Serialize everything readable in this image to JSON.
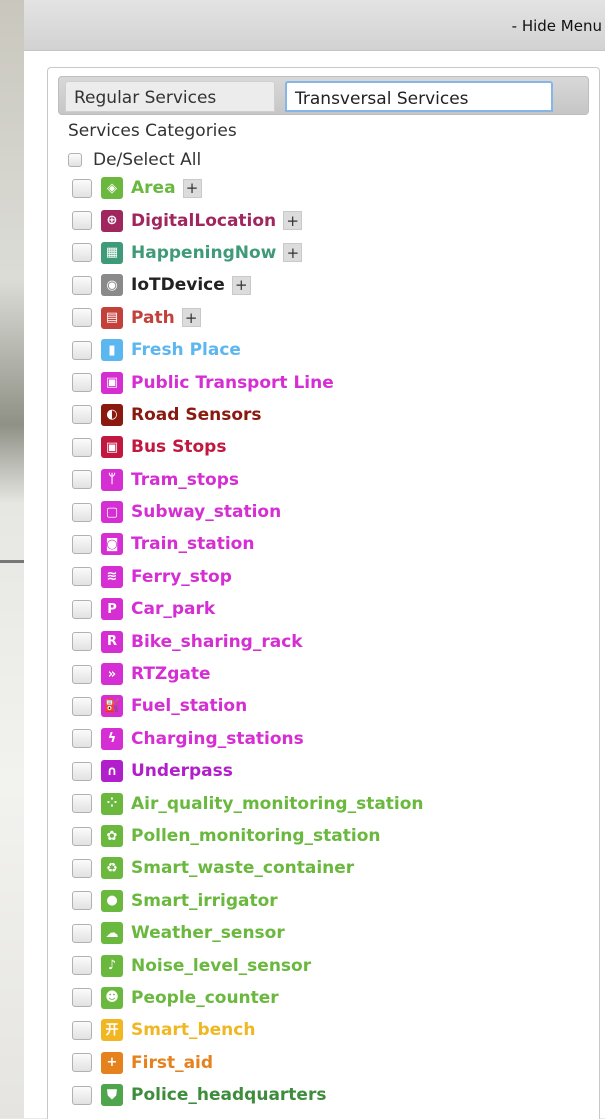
{
  "header": {
    "hide_menu": "- Hide Menu"
  },
  "tabs": [
    {
      "label": "Regular Services",
      "active": false
    },
    {
      "label": "Transversal Services",
      "active": true
    }
  ],
  "section": {
    "title": "Services Categories",
    "select_all": "De/Select All"
  },
  "categories": [
    {
      "label": "Area",
      "color": "#6ab83e",
      "icon_color": "#6ab83e",
      "icon": "area-icon",
      "glyph": "◈",
      "expandable": true,
      "plus": "+"
    },
    {
      "label": "DigitalLocation",
      "color": "#a0275e",
      "icon_color": "#a0275e",
      "icon": "digital-location-icon",
      "glyph": "⊕",
      "expandable": true,
      "plus": "+"
    },
    {
      "label": "HappeningNow",
      "color": "#3e9a78",
      "icon_color": "#3e9a78",
      "icon": "calendar-icon",
      "glyph": "▦",
      "expandable": true,
      "plus": "+"
    },
    {
      "label": "IoTDevice",
      "color": "#222222",
      "icon_color": "#8a8a8a",
      "icon": "map-pin-icon",
      "glyph": "◉",
      "expandable": true,
      "plus": "+"
    },
    {
      "label": "Path",
      "color": "#c2413b",
      "icon_color": "#c2413b",
      "icon": "path-icon",
      "glyph": "▤",
      "expandable": true,
      "plus": "+"
    },
    {
      "label": "Fresh Place",
      "color": "#5cb6f0",
      "icon_color": "#5cb6f0",
      "icon": "fresh-place-icon",
      "glyph": "▮",
      "expandable": false
    },
    {
      "label": "Public Transport Line",
      "color": "#d52ed3",
      "icon_color": "#d52ed3",
      "icon": "bus-icon",
      "glyph": "▣",
      "expandable": false
    },
    {
      "label": "Road Sensors",
      "color": "#8a1a10",
      "icon_color": "#8a1a10",
      "icon": "road-sensor-icon",
      "glyph": "◐",
      "expandable": false
    },
    {
      "label": "Bus Stops",
      "color": "#c0183e",
      "icon_color": "#c0183e",
      "icon": "bus-stop-icon",
      "glyph": "▣",
      "expandable": false
    },
    {
      "label": "Tram_stops",
      "color": "#d52ed3",
      "icon_color": "#d52ed3",
      "icon": "tram-icon",
      "glyph": "ᛘ",
      "expandable": false
    },
    {
      "label": "Subway_station",
      "color": "#d52ed3",
      "icon_color": "#d52ed3",
      "icon": "subway-icon",
      "glyph": "▢",
      "expandable": false
    },
    {
      "label": "Train_station",
      "color": "#d52ed3",
      "icon_color": "#d52ed3",
      "icon": "train-icon",
      "glyph": "◙",
      "expandable": false
    },
    {
      "label": "Ferry_stop",
      "color": "#d52ed3",
      "icon_color": "#d52ed3",
      "icon": "ferry-icon",
      "glyph": "≋",
      "expandable": false
    },
    {
      "label": "Car_park",
      "color": "#d52ed3",
      "icon_color": "#d52ed3",
      "icon": "car-park-icon",
      "glyph": "P",
      "expandable": false
    },
    {
      "label": "Bike_sharing_rack",
      "color": "#d52ed3",
      "icon_color": "#d52ed3",
      "icon": "bike-sharing-icon",
      "glyph": "R",
      "expandable": false
    },
    {
      "label": "RTZgate",
      "color": "#d52ed3",
      "icon_color": "#d52ed3",
      "icon": "gate-icon",
      "glyph": "»",
      "expandable": false
    },
    {
      "label": "Fuel_station",
      "color": "#d52ed3",
      "icon_color": "#d52ed3",
      "icon": "fuel-icon",
      "glyph": "⛽",
      "expandable": false
    },
    {
      "label": "Charging_stations",
      "color": "#d52ed3",
      "icon_color": "#d52ed3",
      "icon": "charging-icon",
      "glyph": "ϟ",
      "expandable": false
    },
    {
      "label": "Underpass",
      "color": "#b01fc9",
      "icon_color": "#b01fc9",
      "icon": "underpass-icon",
      "glyph": "∩",
      "expandable": false
    },
    {
      "label": "Air_quality_monitoring_station",
      "color": "#6ab83e",
      "icon_color": "#6ab83e",
      "icon": "air-quality-icon",
      "glyph": "⁘",
      "expandable": false
    },
    {
      "label": "Pollen_monitoring_station",
      "color": "#6ab83e",
      "icon_color": "#6ab83e",
      "icon": "pollen-icon",
      "glyph": "✿",
      "expandable": false
    },
    {
      "label": "Smart_waste_container",
      "color": "#6ab83e",
      "icon_color": "#6ab83e",
      "icon": "recycle-icon",
      "glyph": "♻",
      "expandable": false
    },
    {
      "label": "Smart_irrigator",
      "color": "#6ab83e",
      "icon_color": "#6ab83e",
      "icon": "water-drop-icon",
      "glyph": "●",
      "expandable": false
    },
    {
      "label": "Weather_sensor",
      "color": "#6ab83e",
      "icon_color": "#6ab83e",
      "icon": "weather-icon",
      "glyph": "☁",
      "expandable": false
    },
    {
      "label": "Noise_level_sensor",
      "color": "#6ab83e",
      "icon_color": "#6ab83e",
      "icon": "noise-icon",
      "glyph": "♪",
      "expandable": false
    },
    {
      "label": "People_counter",
      "color": "#6ab83e",
      "icon_color": "#6ab83e",
      "icon": "people-icon",
      "glyph": "☻",
      "expandable": false
    },
    {
      "label": "Smart_bench",
      "color": "#f0b723",
      "icon_color": "#f0b723",
      "icon": "bench-icon",
      "glyph": "开",
      "expandable": false
    },
    {
      "label": "First_aid",
      "color": "#e5821d",
      "icon_color": "#e5821d",
      "icon": "first-aid-icon",
      "glyph": "+",
      "expandable": false
    },
    {
      "label": "Police_headquarters",
      "color": "#3d8d3d",
      "icon_color": "#4fa54b",
      "icon": "police-shield-icon",
      "glyph": "⛊",
      "expandable": false
    }
  ]
}
